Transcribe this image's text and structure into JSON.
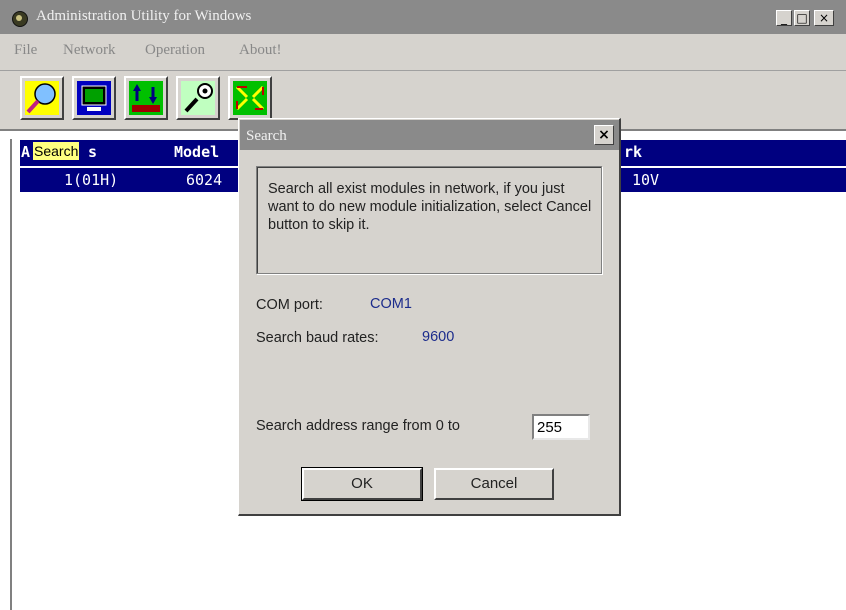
{
  "window": {
    "title": "Administration Utility for Windows",
    "min": "_",
    "max": "□",
    "close": "×"
  },
  "menu": [
    "File",
    "Network",
    "Operation",
    "About!"
  ],
  "toolbar": {
    "icons": [
      "search-icon",
      "monitor-icon",
      "transfer-icon",
      "connect-icon",
      "network-icon"
    ]
  },
  "list": {
    "headers": [
      "A",
      "s",
      "Model",
      "rk"
    ],
    "rows": [
      {
        "address": "1(01H)",
        "model": "6024",
        "range": "10V"
      }
    ]
  },
  "tooltip": "Search",
  "dialog": {
    "title": "Search",
    "close": "×",
    "message": "Search all exist  modules in network, if you just want to do new module initialization, select Cancel button to skip it.",
    "com_port_label": "COM port:",
    "com_port_value": "COM1",
    "baud_label": "Search baud rates:",
    "baud_value": "9600",
    "range_label": "Search address range from 0 to",
    "range_value": "255",
    "ok": "OK",
    "cancel": "Cancel"
  }
}
